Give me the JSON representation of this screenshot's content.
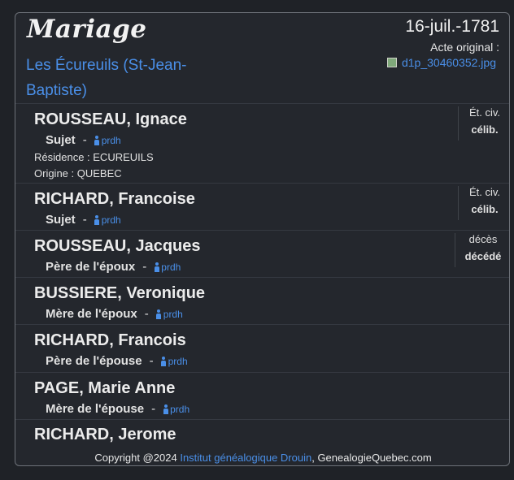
{
  "header": {
    "title": "Mariage",
    "date": "16-juil.-1781",
    "acte_label": "Acte original :",
    "acte_file": "d1p_30460352.jpg",
    "place": "Les Écureuils (St-Jean-Baptiste)"
  },
  "people": [
    {
      "name": "ROUSSEAU, Ignace",
      "role": "Sujet",
      "link": "prdh",
      "residence": "Résidence : ECUREUILS",
      "origine": "Origine : QUEBEC",
      "status_label": "Ét. civ.",
      "status_value": "célib."
    },
    {
      "name": "RICHARD, Francoise",
      "role": "Sujet",
      "link": "prdh",
      "status_label": "Ét. civ.",
      "status_value": "célib."
    },
    {
      "name": "ROUSSEAU, Jacques",
      "role": "Père de l'époux",
      "link": "prdh",
      "status_label": "décès",
      "status_value": "décédé"
    },
    {
      "name": "BUSSIERE, Veronique",
      "role": "Mère de l'époux",
      "link": "prdh"
    },
    {
      "name": "RICHARD, Francois",
      "role": "Père de l'épouse",
      "link": "prdh"
    },
    {
      "name": "PAGE, Marie Anne",
      "role": "Mère de l'épouse",
      "link": "prdh"
    },
    {
      "name": "RICHARD, Jerome"
    }
  ],
  "footer": {
    "prefix": "Copyright @2024 ",
    "link": "Institut généalogique Drouin",
    "suffix": ", GenealogieQuebec.com"
  }
}
